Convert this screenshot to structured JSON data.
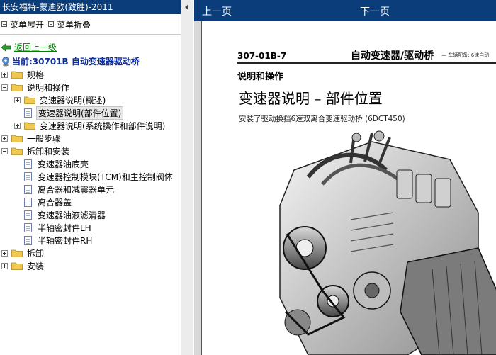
{
  "left": {
    "title": "长安福特-蒙迪欧(致胜)-2011",
    "expand_all": "菜单展开",
    "collapse_all": "菜单折叠",
    "back": "返回上一级",
    "current": "当前:30701B 自动变速器驱动桥"
  },
  "tree": [
    {
      "label": "规格",
      "level": 0,
      "type": "folder",
      "state": "collapsed"
    },
    {
      "label": "说明和操作",
      "level": 0,
      "type": "folder",
      "state": "expanded"
    },
    {
      "label": "变速器说明(概述)",
      "level": 1,
      "type": "folder",
      "state": "collapsed"
    },
    {
      "label": "变速器说明(部件位置)",
      "level": 1,
      "type": "doc",
      "selected": true
    },
    {
      "label": "变速器说明(系统操作和部件说明)",
      "level": 1,
      "type": "folder",
      "state": "collapsed"
    },
    {
      "label": "一般步骤",
      "level": 0,
      "type": "folder",
      "state": "collapsed"
    },
    {
      "label": "拆卸和安装",
      "level": 0,
      "type": "folder",
      "state": "expanded"
    },
    {
      "label": "变速器油底壳",
      "level": 1,
      "type": "doc"
    },
    {
      "label": "变速器控制模块(TCM)和主控制阀体",
      "level": 1,
      "type": "doc"
    },
    {
      "label": "离合器和减震器单元",
      "level": 1,
      "type": "doc"
    },
    {
      "label": "离合器盖",
      "level": 1,
      "type": "doc"
    },
    {
      "label": "变速器油液滤清器",
      "level": 1,
      "type": "doc"
    },
    {
      "label": "半轴密封件LH",
      "level": 1,
      "type": "doc"
    },
    {
      "label": "半轴密封件RH",
      "level": 1,
      "type": "doc"
    },
    {
      "label": "拆卸",
      "level": 0,
      "type": "folder",
      "state": "collapsed"
    },
    {
      "label": "安装",
      "level": 0,
      "type": "folder",
      "state": "collapsed"
    }
  ],
  "nav": {
    "prev": "上一页",
    "next": "下一页"
  },
  "doc": {
    "code": "307-01B-7",
    "heading": "自动变速器/驱动桥",
    "subheading": "— 车辆配备: 6速自动",
    "section": "说明和操作",
    "title": "变速器说明 – 部件位置",
    "caption": "安装了驱动换挡6速双离合变速驱动桥 (6DCT450)"
  },
  "colors": {
    "title_bar": "#0a3d7a",
    "link_green": "#008000",
    "current_blue": "#0b2c9c",
    "folder_yellow": "#f2c94c"
  }
}
